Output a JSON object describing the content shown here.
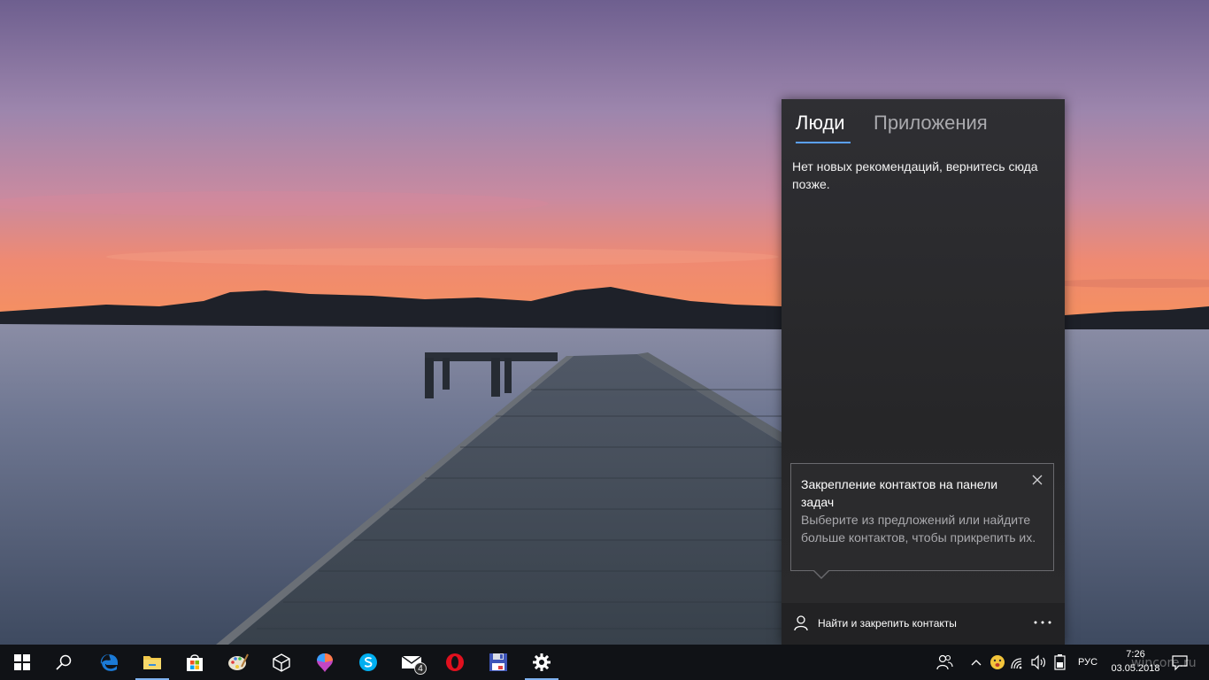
{
  "people_panel": {
    "tabs": [
      {
        "label": "Люди",
        "active": true
      },
      {
        "label": "Приложения",
        "active": false
      }
    ],
    "empty_message": "Нет новых рекомендаций, вернитесь сюда позже.",
    "tip": {
      "title": "Закрепление контактов на панели задач",
      "body": "Выберите из предложений или найдите больше контактов, чтобы прикрепить их."
    },
    "footer": {
      "find_label": "Найти и закрепить контакты"
    }
  },
  "taskbar": {
    "apps": [
      {
        "name": "start",
        "icon": "windows-logo-icon"
      },
      {
        "name": "search",
        "icon": "search-icon"
      },
      {
        "name": "edge",
        "icon": "edge-icon"
      },
      {
        "name": "file-explorer",
        "icon": "folder-icon",
        "active": true
      },
      {
        "name": "store",
        "icon": "store-icon"
      },
      {
        "name": "paint",
        "icon": "paint-palette-icon"
      },
      {
        "name": "3d-viewer",
        "icon": "cube-icon"
      },
      {
        "name": "paint-3d",
        "icon": "paint-3d-icon"
      },
      {
        "name": "skype",
        "icon": "skype-icon"
      },
      {
        "name": "mail",
        "icon": "mail-icon",
        "badge": "4"
      },
      {
        "name": "opera",
        "icon": "opera-icon"
      },
      {
        "name": "save-app",
        "icon": "floppy-icon"
      },
      {
        "name": "settings",
        "icon": "gear-icon",
        "active": true
      }
    ],
    "tray": {
      "language": "РУС",
      "time": "7:26",
      "date": "03.05.2018"
    },
    "watermark": "wincore.ru"
  },
  "colors": {
    "taskbar": "#101216",
    "accent": "#5aa0ff",
    "panel": "#2b2b2d"
  }
}
